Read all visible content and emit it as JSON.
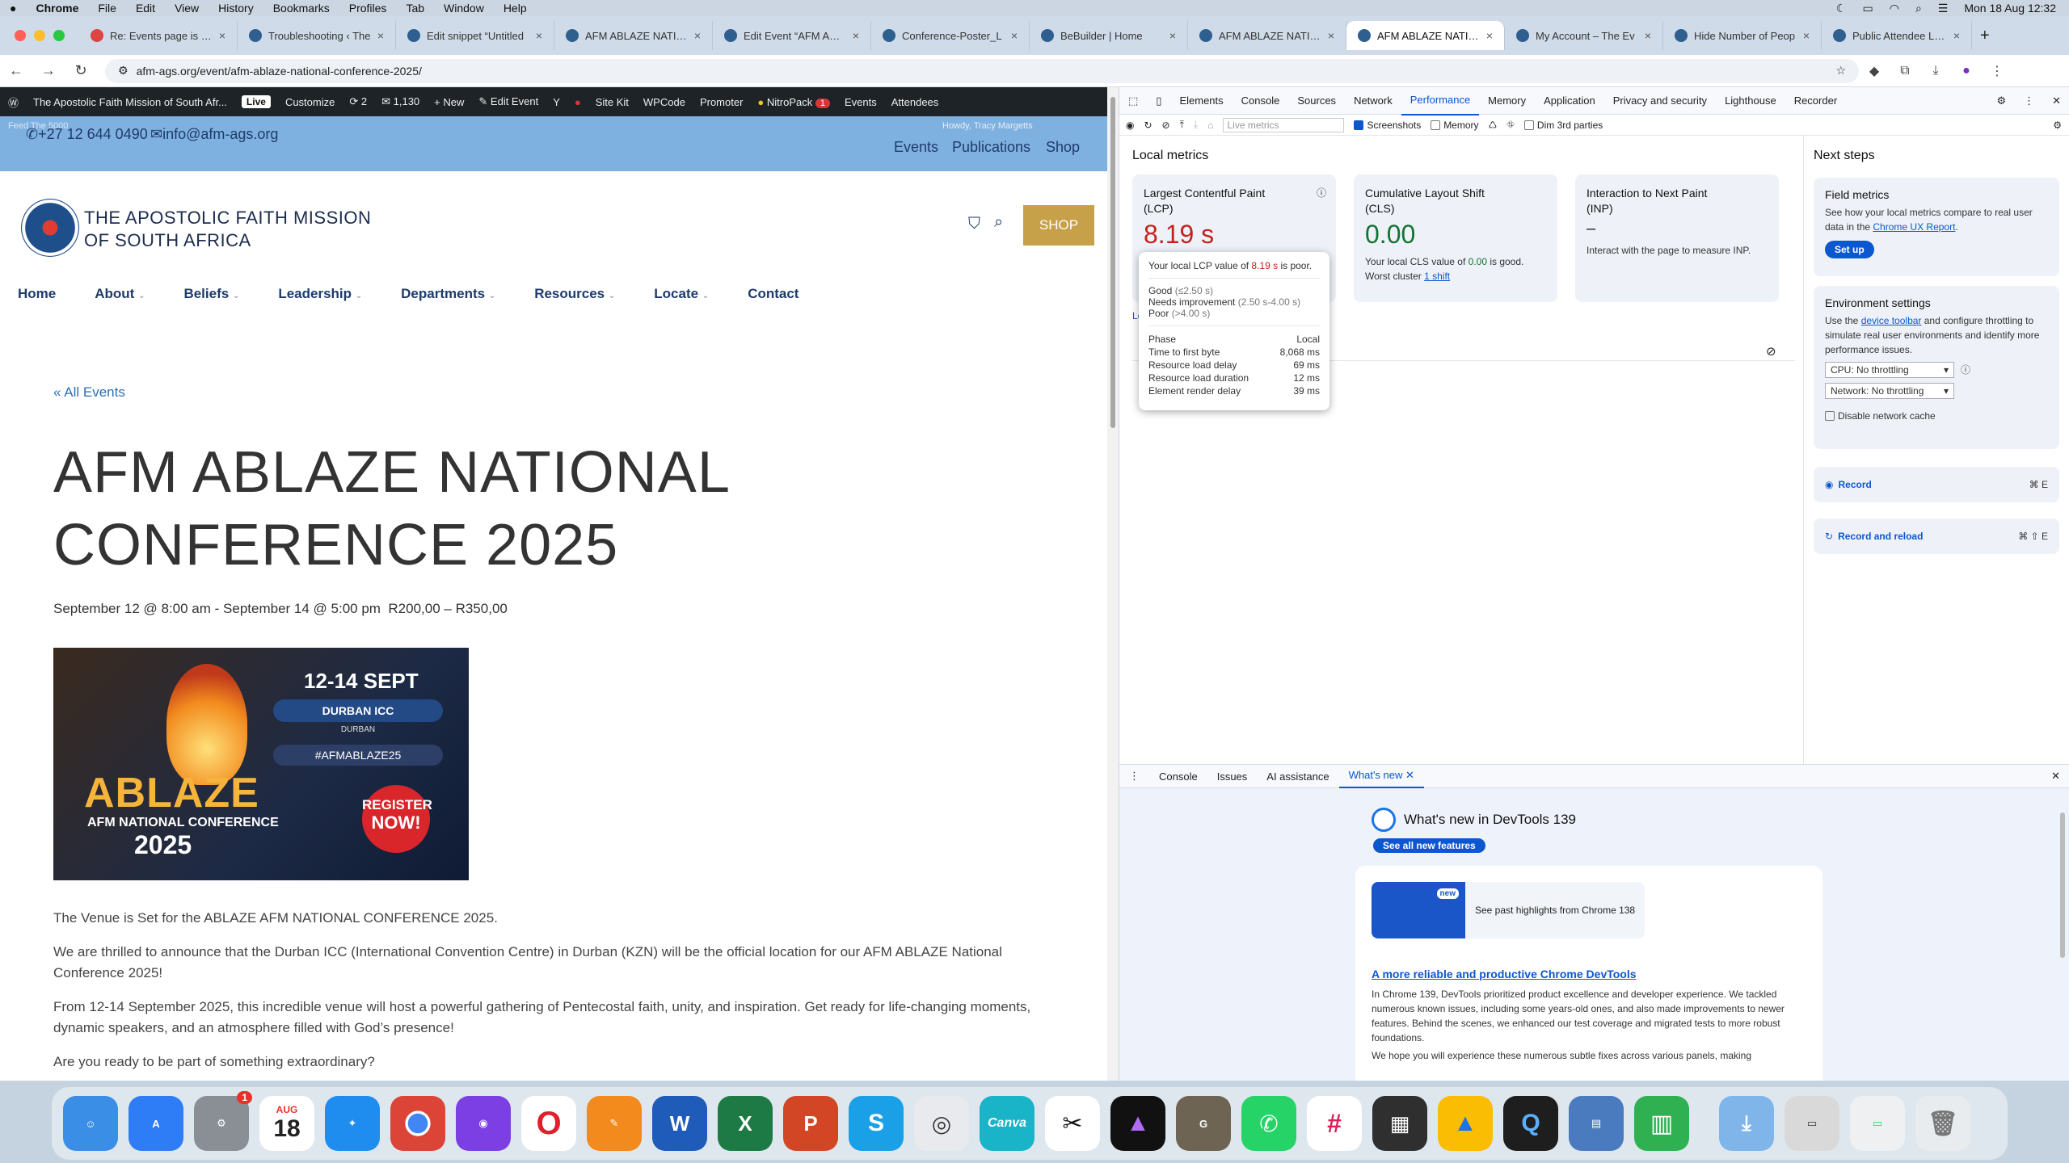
{
  "menubar": {
    "app": "Chrome",
    "items": [
      "File",
      "Edit",
      "View",
      "History",
      "Bookmarks",
      "Profiles",
      "Tab",
      "Window",
      "Help"
    ],
    "clock": "Mon 18 Aug  12:32"
  },
  "tabs": [
    {
      "label": "Re: Events page is loa"
    },
    {
      "label": "Troubleshooting ‹ The"
    },
    {
      "label": "Edit snippet “Untitled"
    },
    {
      "label": "AFM ABLAZE NATION"
    },
    {
      "label": "Edit Event “AFM ABLA"
    },
    {
      "label": "Conference-Poster_L"
    },
    {
      "label": "BeBuilder | Home"
    },
    {
      "label": "AFM ABLAZE NATION"
    },
    {
      "label": "AFM ABLAZE NATION"
    },
    {
      "label": "My Account – The Ev"
    },
    {
      "label": "Hide Number of Peop"
    },
    {
      "label": "Public Attendee List -"
    }
  ],
  "address": {
    "url": "afm-ags.org/event/afm-ablaze-national-conference-2025/"
  },
  "wpbar": {
    "site": "The Apostolic Faith Mission of South Afr...",
    "live": "Live",
    "customize": "Customize",
    "updates": "2",
    "comments": "1,130",
    "new": "New",
    "edit": "Edit Event",
    "sitekit": "Site Kit",
    "wpcode": "WPCode",
    "promoter": "Promoter",
    "nitro": "NitroPack",
    "nitro_badge": "1",
    "events": "Events",
    "attendees": "Attendees"
  },
  "top": {
    "phone": "+27 12 644 0490",
    "email": "info@afm-ags.org",
    "howdy": "Howdy, Tracy Margetts",
    "links": [
      "Events",
      "Publications",
      "Shop"
    ],
    "feed": "Feed The 5000"
  },
  "site": {
    "name1": "THE APOSTOLIC FAITH MISSION",
    "name2": "OF SOUTH AFRICA",
    "shop": "SHOP"
  },
  "nav": [
    "Home",
    "About",
    "Beliefs",
    "Leadership",
    "Departments",
    "Resources",
    "Locate",
    "Contact"
  ],
  "event": {
    "back": "« All Events",
    "title1": "AFM ABLAZE NATIONAL",
    "title2": "CONFERENCE 2025",
    "meta": "September 12 @ 8:00 am - September 14 @ 5:00 pm",
    "price": "R200,00 – R350,00"
  },
  "poster": {
    "dates": "12-14 SEPT",
    "venue": "DURBAN ICC",
    "city": "DURBAN",
    "tag": "#AFMABLAZE25",
    "brand": "ABLAZE",
    "conf": "AFM NATIONAL CONFERENCE",
    "year": "2025",
    "cta1": "REGISTER",
    "cta2": "NOW!"
  },
  "paras": [
    "The Venue is Set for the ABLAZE AFM NATIONAL CONFERENCE 2025.",
    "We are thrilled to announce that the Durban ICC (International Convention Centre) in Durban (KZN) will be the official location for our AFM ABLAZE National Conference 2025!",
    "From 12-14 September 2025, this incredible venue will host a powerful gathering of Pentecostal faith, unity, and inspiration. Get ready for life-changing moments, dynamic speakers, and an atmosphere filled with God’s presence!",
    "Are you ready to be part of something extraordinary?"
  ],
  "devtools": {
    "tabs": [
      "Elements",
      "Console",
      "Sources",
      "Network",
      "Performance",
      "Memory",
      "Application",
      "Privacy and security",
      "Lighthouse",
      "Recorder"
    ],
    "live": "Live metrics",
    "screenshots": "Screenshots",
    "memory": "Memory",
    "dim": "Dim 3rd parties",
    "local_title": "Local metrics",
    "lcp": {
      "title1": "Largest Contentful Paint",
      "title2": "(LCP)",
      "value": "8.19 s"
    },
    "cls": {
      "title1": "Cumulative Layout Shift",
      "title2": "(CLS)",
      "value": "0.00",
      "desc_a": "Your local CLS value of ",
      "desc_v": "0.00",
      "desc_b": " is good.",
      "worst": "Worst cluster ",
      "worst_link": "1 shift"
    },
    "inp": {
      "title1": "Interaction to Next Paint",
      "title2": "(INP)",
      "value": "–",
      "desc": "Interact with the page to measure INP."
    },
    "tip": {
      "desc_a": "Your local LCP value of ",
      "desc_v": "8.19 s",
      "desc_b": " is poor.",
      "good": "Good",
      "good_r": " (≤2.50 s)",
      "ni": "Needs improvement",
      "ni_r": " (2.50 s-4.00 s)",
      "poor": "Poor",
      "poor_r": " (>4.00 s)",
      "phase": "Phase",
      "local": "Local",
      "rows": [
        [
          "Time to first byte",
          "8,068 ms"
        ],
        [
          "Resource load delay",
          "69 ms"
        ],
        [
          "Resource load duration",
          "12 ms"
        ],
        [
          "Element render delay",
          "39 ms"
        ]
      ]
    },
    "next": {
      "title": "Next steps",
      "field_h": "Field metrics",
      "field_a": "See how your local metrics compare to real user data in the ",
      "field_link": "Chrome UX Report",
      "field_b": ".",
      "setup": "Set up",
      "env_h": "Environment settings",
      "env_a": "Use the ",
      "env_link": "device toolbar",
      "env_b": " and configure throttling to simulate real user environments and identify more performance issues.",
      "cpu": "CPU: No throttling",
      "net": "Network: No throttling",
      "cache": "Disable network cache",
      "record": "Record",
      "record_k": "⌘ E",
      "reload": "Record and reload",
      "reload_k": "⌘ ⇧ E"
    },
    "drawer": {
      "tabs": [
        "Console",
        "Issues",
        "AI assistance",
        "What's new"
      ],
      "title": "What's new in DevTools 139",
      "see_all": "See all new features",
      "past": "See past highlights from Chrome 138",
      "new": "new",
      "link": "A more reliable and productive Chrome DevTools",
      "text1": "In Chrome 139, DevTools prioritized product excellence and developer experience. We tackled numerous known issues, including some years-old ones, and also made improvements to newer features. Behind the scenes, we enhanced our test coverage and migrated tests to more robust foundations.",
      "text2": "We hope you will experience these numerous subtle fixes across various panels, making"
    }
  },
  "dock": {
    "cal_month": "AUG",
    "cal_day": "18",
    "settings_badge": "1",
    "canva": "Canva"
  }
}
